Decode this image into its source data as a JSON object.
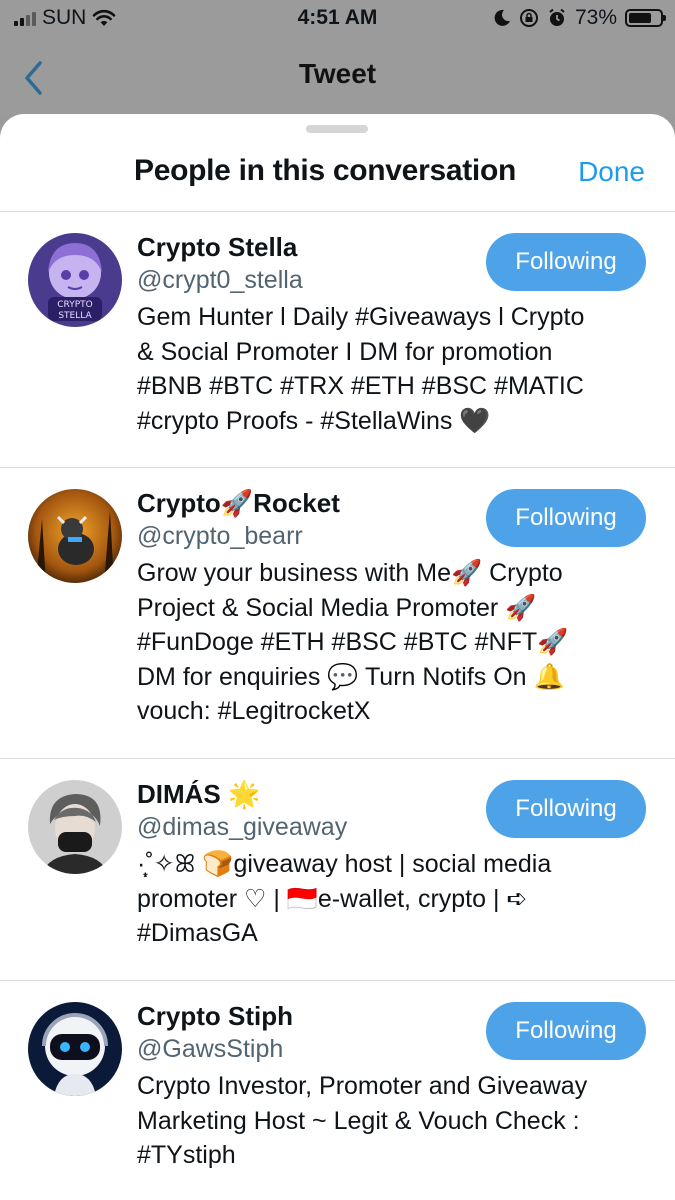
{
  "status_bar": {
    "carrier": "SUN",
    "time": "4:51 AM",
    "battery_text": "73%",
    "battery_level": 0.73
  },
  "nav": {
    "back_icon": "chevron-left-icon",
    "title": "Tweet"
  },
  "sheet": {
    "title": "People in this conversation",
    "done_label": "Done"
  },
  "colors": {
    "accent": "#1d9bf0",
    "follow_button": "#4ea2e8",
    "handle_gray": "#536471"
  },
  "users": [
    {
      "name": "Crypto Stella",
      "handle": "@crypt0_stella",
      "bio": "Gem Hunter l Daily #Giveaways l Crypto\n& Social Promoter I DM for promotion\n#BNB #BTC #TRX #ETH #BSC #MATIC\n#crypto Proofs - #StellaWins 🖤",
      "button": "Following"
    },
    {
      "name": "Crypto🚀Rocket",
      "handle": "@crypto_bearr",
      "bio": "Grow your business with Me🚀 Crypto\nProject & Social Media Promoter 🚀\n#FunDoge #ETH #BSC #BTC #NFT🚀\nDM for enquiries 💬 Turn Notifs On 🔔\nvouch: #LegitrocketX",
      "button": "Following"
    },
    {
      "name": "DIMÁS 🌟",
      "handle": "@dimas_giveaway",
      "bio": "·̩͙˚✧ꕤ 🍞giveaway host | social media\npromoter ♡ | 🇮🇩e-wallet, crypto | ➪\n#DimasGA",
      "button": "Following"
    },
    {
      "name": "Crypto Stiph",
      "handle": "@GawsStiph",
      "bio": "Crypto Investor, Promoter and Giveaway\nMarketing Host ~ Legit & Vouch Check :\n#TYstiph",
      "button": "Following"
    }
  ]
}
